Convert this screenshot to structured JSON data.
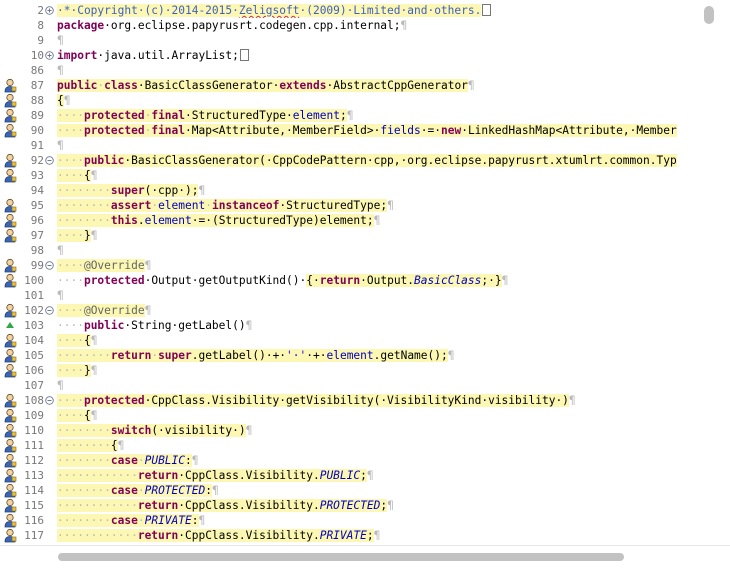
{
  "editor": {
    "lines": [
      {
        "n": "2",
        "fold": "+",
        "marker": "",
        "tokens": [
          {
            "t": "·*·Copyright·(c)·2014-2015·",
            "c": "cm hl"
          },
          {
            "t": "Zeligsoft",
            "c": "cm hl sq"
          },
          {
            "t": "·(2009)·Limited·and·others.",
            "c": "cm hl"
          },
          {
            "t": "box",
            "c": "box"
          }
        ]
      },
      {
        "n": "8",
        "fold": "",
        "marker": "",
        "tokens": [
          {
            "t": "package",
            "c": "kw"
          },
          {
            "t": "·org.eclipse.papyrusrt.codegen.cpp.internal;",
            "c": ""
          },
          {
            "t": "¶",
            "c": "ws"
          }
        ]
      },
      {
        "n": "9",
        "fold": "",
        "marker": "",
        "tokens": [
          {
            "t": "¶",
            "c": "ws"
          }
        ]
      },
      {
        "n": "10",
        "fold": "+",
        "marker": "",
        "tokens": [
          {
            "t": "import",
            "c": "kw"
          },
          {
            "t": "·java.util.ArrayList;",
            "c": ""
          },
          {
            "t": "box",
            "c": "box"
          }
        ]
      },
      {
        "n": "86",
        "fold": "",
        "marker": "",
        "tokens": [
          {
            "t": "¶",
            "c": "ws"
          }
        ]
      },
      {
        "n": "87",
        "fold": "",
        "marker": "person",
        "tokens": [
          {
            "t": "public",
            "c": "kw hl"
          },
          {
            "t": "·",
            "c": "ws hl"
          },
          {
            "t": "class",
            "c": "kw hl"
          },
          {
            "t": "·BasicClassGenerator·",
            "c": "hl"
          },
          {
            "t": "extends",
            "c": "kw hl"
          },
          {
            "t": "·AbstractCppGenerator",
            "c": "hl"
          },
          {
            "t": "¶",
            "c": "ws"
          }
        ]
      },
      {
        "n": "88",
        "fold": "",
        "marker": "person",
        "tokens": [
          {
            "t": "{",
            "c": "hl"
          },
          {
            "t": "¶",
            "c": "ws"
          }
        ]
      },
      {
        "n": "89",
        "fold": "",
        "marker": "person",
        "tokens": [
          {
            "t": "····",
            "c": "ws hl"
          },
          {
            "t": "protected",
            "c": "kw hl"
          },
          {
            "t": "·",
            "c": "ws hl"
          },
          {
            "t": "final",
            "c": "kw hl"
          },
          {
            "t": "·StructuredType·",
            "c": "hl"
          },
          {
            "t": "element",
            "c": "id hl"
          },
          {
            "t": ";",
            "c": "hl"
          },
          {
            "t": "¶",
            "c": "ws"
          }
        ]
      },
      {
        "n": "90",
        "fold": "",
        "marker": "person",
        "tokens": [
          {
            "t": "····",
            "c": "ws hl"
          },
          {
            "t": "protected",
            "c": "kw hl"
          },
          {
            "t": "·",
            "c": "ws hl"
          },
          {
            "t": "final",
            "c": "kw hl"
          },
          {
            "t": "·Map<Attribute,·MemberField>·",
            "c": "hl"
          },
          {
            "t": "fields",
            "c": "id hl"
          },
          {
            "t": "·=·",
            "c": "hl"
          },
          {
            "t": "new",
            "c": "kw hl"
          },
          {
            "t": "·LinkedHashMap<Attribute,·Member",
            "c": "hl"
          }
        ]
      },
      {
        "n": "91",
        "fold": "",
        "marker": "",
        "tokens": [
          {
            "t": "¶",
            "c": "ws"
          }
        ]
      },
      {
        "n": "92",
        "fold": "−",
        "marker": "person",
        "tokens": [
          {
            "t": "····",
            "c": "ws hl"
          },
          {
            "t": "public",
            "c": "kw hl"
          },
          {
            "t": "·BasicClassGenerator(·CppCodePattern·cpp,·org.eclipse.papyrusrt.xtumlrt.common.Typ",
            "c": "hl"
          }
        ]
      },
      {
        "n": "93",
        "fold": "",
        "marker": "person",
        "tokens": [
          {
            "t": "····",
            "c": "ws hl"
          },
          {
            "t": "{",
            "c": "hl"
          },
          {
            "t": "¶",
            "c": "ws"
          }
        ]
      },
      {
        "n": "94",
        "fold": "",
        "marker": "",
        "tokens": [
          {
            "t": "········",
            "c": "ws hl"
          },
          {
            "t": "super",
            "c": "kw hl"
          },
          {
            "t": "(·cpp·);",
            "c": "hl"
          },
          {
            "t": "¶",
            "c": "ws"
          }
        ]
      },
      {
        "n": "95",
        "fold": "",
        "marker": "person",
        "tokens": [
          {
            "t": "········",
            "c": "ws hl"
          },
          {
            "t": "assert",
            "c": "kw hl"
          },
          {
            "t": "·",
            "c": "ws hl"
          },
          {
            "t": "element",
            "c": "id hl"
          },
          {
            "t": "·",
            "c": "ws hl"
          },
          {
            "t": "instanceof",
            "c": "kw hl"
          },
          {
            "t": "·StructuredType;",
            "c": "hl"
          },
          {
            "t": "¶",
            "c": "ws"
          }
        ]
      },
      {
        "n": "96",
        "fold": "",
        "marker": "person",
        "tokens": [
          {
            "t": "········",
            "c": "ws hl"
          },
          {
            "t": "this",
            "c": "kw hl"
          },
          {
            "t": ".",
            "c": "hl"
          },
          {
            "t": "element",
            "c": "id hl"
          },
          {
            "t": "·=·(StructuredType)element;",
            "c": "hl"
          },
          {
            "t": "¶",
            "c": "ws"
          }
        ]
      },
      {
        "n": "97",
        "fold": "",
        "marker": "person",
        "tokens": [
          {
            "t": "····",
            "c": "ws hl"
          },
          {
            "t": "}",
            "c": "hl"
          },
          {
            "t": "¶",
            "c": "ws"
          }
        ]
      },
      {
        "n": "98",
        "fold": "",
        "marker": "",
        "tokens": [
          {
            "t": "¶",
            "c": "ws"
          }
        ]
      },
      {
        "n": "99",
        "fold": "−",
        "marker": "person",
        "tokens": [
          {
            "t": "····",
            "c": "ws hl"
          },
          {
            "t": "@Override",
            "c": "an hl"
          },
          {
            "t": "¶",
            "c": "ws"
          }
        ]
      },
      {
        "n": "100",
        "fold": "",
        "marker": "person",
        "tokens": [
          {
            "t": "····",
            "c": "ws"
          },
          {
            "t": "protected",
            "c": "kw"
          },
          {
            "t": "·Output·getOutputKind()·",
            "c": ""
          },
          {
            "t": "{·",
            "c": "hl"
          },
          {
            "t": "return",
            "c": "kw hl"
          },
          {
            "t": "·Output.",
            "c": "hl"
          },
          {
            "t": "BasicClass",
            "c": "con hl"
          },
          {
            "t": ";·}",
            "c": "hl"
          },
          {
            "t": "¶",
            "c": "ws"
          }
        ]
      },
      {
        "n": "101",
        "fold": "",
        "marker": "",
        "tokens": [
          {
            "t": "¶",
            "c": "ws"
          }
        ]
      },
      {
        "n": "102",
        "fold": "−",
        "marker": "person",
        "tokens": [
          {
            "t": "····",
            "c": "ws hl"
          },
          {
            "t": "@Override",
            "c": "an hl"
          },
          {
            "t": "¶",
            "c": "ws"
          }
        ]
      },
      {
        "n": "103",
        "fold": "",
        "marker": "triangle",
        "tokens": [
          {
            "t": "····",
            "c": "ws"
          },
          {
            "t": "public",
            "c": "kw"
          },
          {
            "t": "·String·getLabel()",
            "c": ""
          },
          {
            "t": "¶",
            "c": "ws"
          }
        ]
      },
      {
        "n": "104",
        "fold": "",
        "marker": "person",
        "tokens": [
          {
            "t": "····",
            "c": "ws hl"
          },
          {
            "t": "{",
            "c": "hl"
          },
          {
            "t": "¶",
            "c": "ws"
          }
        ]
      },
      {
        "n": "105",
        "fold": "",
        "marker": "person",
        "tokens": [
          {
            "t": "········",
            "c": "ws hl"
          },
          {
            "t": "return",
            "c": "kw hl"
          },
          {
            "t": "·",
            "c": "ws hl"
          },
          {
            "t": "super",
            "c": "kw hl"
          },
          {
            "t": ".getLabel()·+·",
            "c": "hl"
          },
          {
            "t": "'·'",
            "c": "st hl"
          },
          {
            "t": "·+·",
            "c": "hl"
          },
          {
            "t": "element",
            "c": "id hl"
          },
          {
            "t": ".getName();",
            "c": "hl"
          },
          {
            "t": "¶",
            "c": "ws"
          }
        ]
      },
      {
        "n": "106",
        "fold": "",
        "marker": "person",
        "tokens": [
          {
            "t": "····",
            "c": "ws hl"
          },
          {
            "t": "}",
            "c": "hl"
          },
          {
            "t": "¶",
            "c": "ws"
          }
        ]
      },
      {
        "n": "107",
        "fold": "",
        "marker": "",
        "tokens": [
          {
            "t": "¶",
            "c": "ws"
          }
        ]
      },
      {
        "n": "108",
        "fold": "−",
        "marker": "person",
        "tokens": [
          {
            "t": "····",
            "c": "ws hl"
          },
          {
            "t": "protected",
            "c": "kw hl"
          },
          {
            "t": "·CppClass.Visibility·getVisibility(·VisibilityKind·visibility·)",
            "c": "hl"
          },
          {
            "t": "¶",
            "c": "ws"
          }
        ]
      },
      {
        "n": "109",
        "fold": "",
        "marker": "person",
        "tokens": [
          {
            "t": "····",
            "c": "ws hl"
          },
          {
            "t": "{",
            "c": "hl"
          },
          {
            "t": "¶",
            "c": "ws"
          }
        ]
      },
      {
        "n": "110",
        "fold": "",
        "marker": "person",
        "tokens": [
          {
            "t": "········",
            "c": "ws hl"
          },
          {
            "t": "switch",
            "c": "kw hl"
          },
          {
            "t": "(·visibility·)",
            "c": "hl"
          },
          {
            "t": "¶",
            "c": "ws"
          }
        ]
      },
      {
        "n": "111",
        "fold": "",
        "marker": "person",
        "tokens": [
          {
            "t": "········",
            "c": "ws hl"
          },
          {
            "t": "{",
            "c": "hl"
          },
          {
            "t": "¶",
            "c": "ws"
          }
        ]
      },
      {
        "n": "112",
        "fold": "",
        "marker": "person",
        "tokens": [
          {
            "t": "········",
            "c": "ws hl"
          },
          {
            "t": "case",
            "c": "kw hl"
          },
          {
            "t": "·",
            "c": "ws hl"
          },
          {
            "t": "PUBLIC",
            "c": "con hl"
          },
          {
            "t": ":",
            "c": "hl"
          },
          {
            "t": "¶",
            "c": "ws"
          }
        ]
      },
      {
        "n": "113",
        "fold": "",
        "marker": "person",
        "tokens": [
          {
            "t": "············",
            "c": "ws hl"
          },
          {
            "t": "return",
            "c": "kw hl"
          },
          {
            "t": "·CppClass.Visibility.",
            "c": "hl"
          },
          {
            "t": "PUBLIC",
            "c": "con hl"
          },
          {
            "t": ";",
            "c": "hl"
          },
          {
            "t": "¶",
            "c": "ws"
          }
        ]
      },
      {
        "n": "114",
        "fold": "",
        "marker": "person",
        "tokens": [
          {
            "t": "········",
            "c": "ws hl"
          },
          {
            "t": "case",
            "c": "kw hl"
          },
          {
            "t": "·",
            "c": "ws hl"
          },
          {
            "t": "PROTECTED",
            "c": "con hl"
          },
          {
            "t": ":",
            "c": "hl"
          },
          {
            "t": "¶",
            "c": "ws"
          }
        ]
      },
      {
        "n": "115",
        "fold": "",
        "marker": "person",
        "tokens": [
          {
            "t": "············",
            "c": "ws hl"
          },
          {
            "t": "return",
            "c": "kw hl"
          },
          {
            "t": "·CppClass.Visibility.",
            "c": "hl"
          },
          {
            "t": "PROTECTED",
            "c": "con hl"
          },
          {
            "t": ";",
            "c": "hl"
          },
          {
            "t": "¶",
            "c": "ws"
          }
        ]
      },
      {
        "n": "116",
        "fold": "",
        "marker": "person",
        "tokens": [
          {
            "t": "········",
            "c": "ws hl"
          },
          {
            "t": "case",
            "c": "kw hl"
          },
          {
            "t": "·",
            "c": "ws hl"
          },
          {
            "t": "PRIVATE",
            "c": "con hl"
          },
          {
            "t": ":",
            "c": "hl"
          },
          {
            "t": "¶",
            "c": "ws"
          }
        ]
      },
      {
        "n": "117",
        "fold": "",
        "marker": "person",
        "tokens": [
          {
            "t": "············",
            "c": "ws hl"
          },
          {
            "t": "return",
            "c": "kw hl"
          },
          {
            "t": "·CppClass.Visibility.",
            "c": "hl"
          },
          {
            "t": "PRIVATE",
            "c": "con hl"
          },
          {
            "t": ";",
            "c": "hl"
          },
          {
            "t": "¶",
            "c": "ws"
          }
        ]
      }
    ]
  },
  "colors": {
    "highlight": "#fcf8b4",
    "keyword": "#7f0055",
    "field": "#0000c0",
    "comment": "#3f5fbf",
    "annotation": "#646464",
    "string": "#2a00ff"
  },
  "icons": {
    "blame_marker": "person-icon",
    "override_marker": "green-triangle-icon",
    "fold_expanded": "minus-icon",
    "fold_collapsed": "plus-icon"
  }
}
